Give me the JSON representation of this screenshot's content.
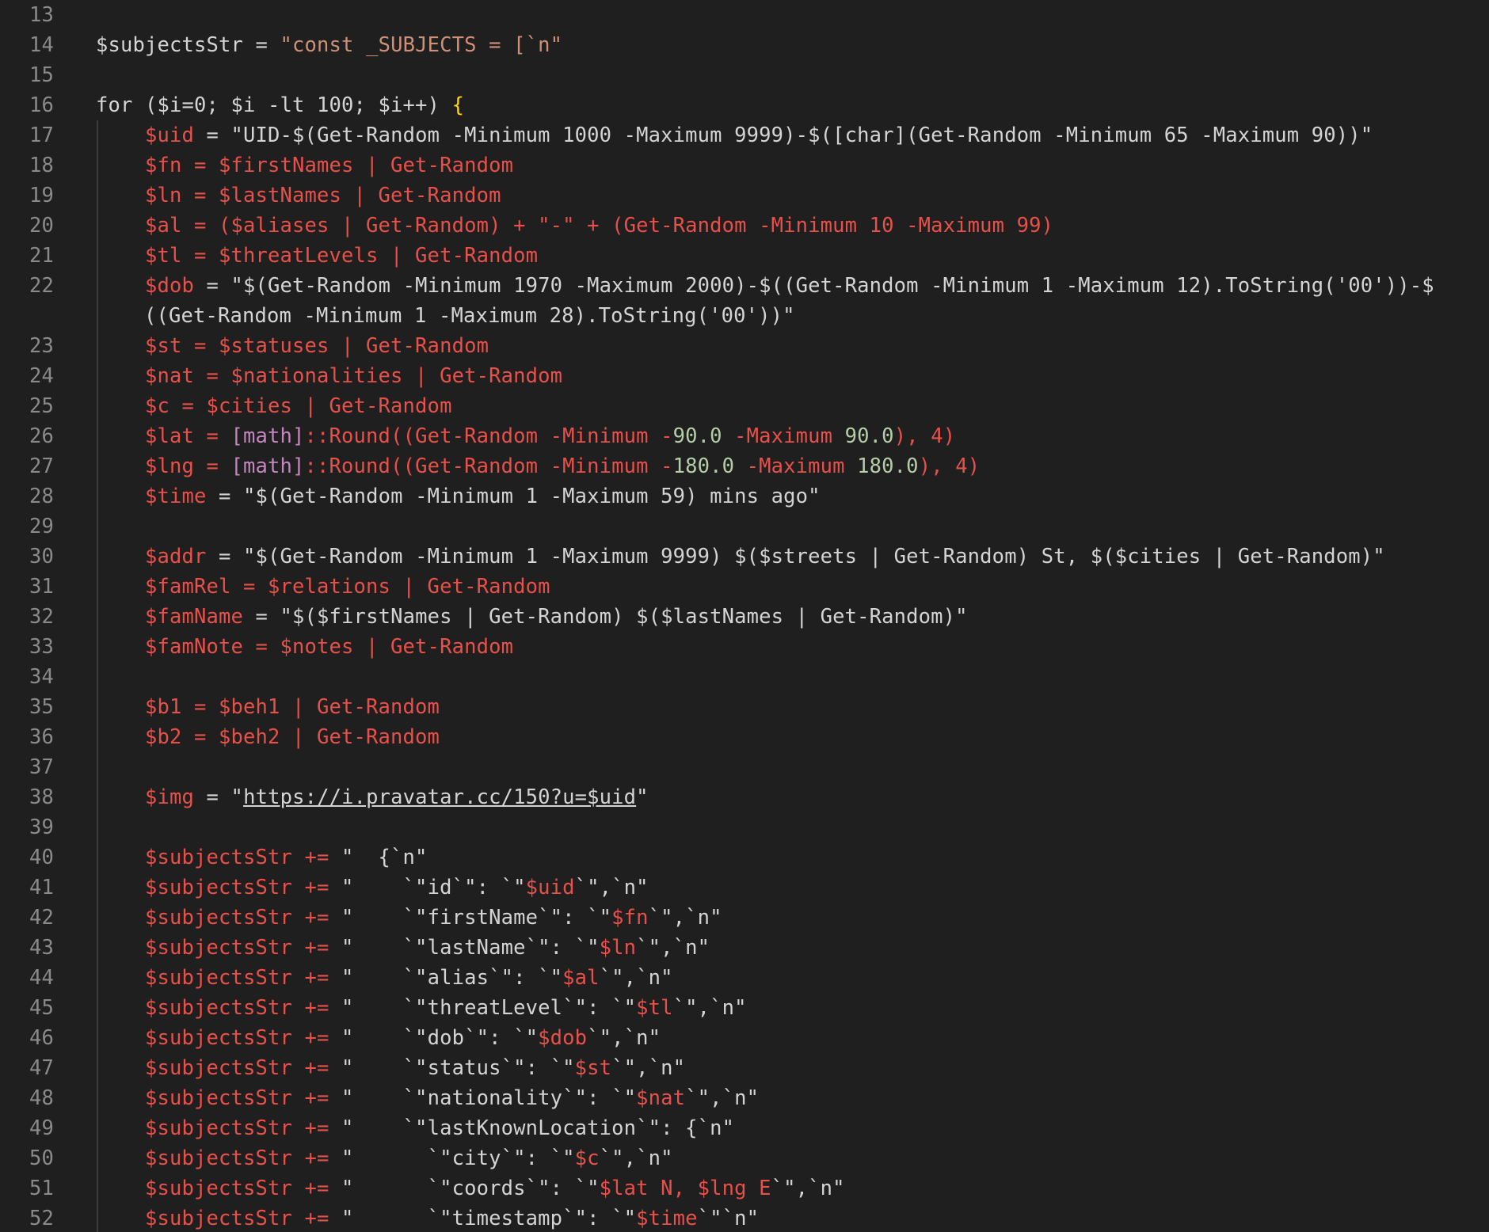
{
  "editor": {
    "colors": {
      "background": "#1f1f1f",
      "gutter_text": "#8a8a8a",
      "plain": "#d4d4d4",
      "variable": "#e8504a",
      "string": "#ce9178",
      "bracket_yellow": "#ffd700",
      "bracket_pink": "#da70d6",
      "number": "#b5cea8",
      "keyword": "#d4d4d4",
      "type": "#c586c0"
    },
    "lines": [
      {
        "n": "13",
        "guide": false,
        "tokens": []
      },
      {
        "n": "14",
        "guide": false,
        "tokens": [
          {
            "t": "$subjectsStr = ",
            "c": "plain"
          },
          {
            "t": "\"const _SUBJECTS = [`n\"",
            "c": "string"
          }
        ]
      },
      {
        "n": "15",
        "guide": false,
        "tokens": []
      },
      {
        "n": "16",
        "guide": false,
        "tokens": [
          {
            "t": "for ($i=0; $i -lt 100; $i++) ",
            "c": "plain"
          },
          {
            "t": "{",
            "c": "bracket_yellow"
          }
        ]
      },
      {
        "n": "17",
        "guide": true,
        "tokens": [
          {
            "t": "    $uid",
            "c": "variable"
          },
          {
            "t": " = ",
            "c": "plain"
          },
          {
            "t": "\"UID-$(Get-Random -Minimum 1000 -Maximum 9999)-$([char](Get-Random -Minimum 65 -Maximum 90))\"",
            "c": "string_light"
          }
        ]
      },
      {
        "n": "18",
        "guide": true,
        "tokens": [
          {
            "t": "    $fn = $firstNames | Get-Random",
            "c": "variable"
          }
        ]
      },
      {
        "n": "19",
        "guide": true,
        "tokens": [
          {
            "t": "    $ln = $lastNames | Get-Random",
            "c": "variable"
          }
        ]
      },
      {
        "n": "20",
        "guide": true,
        "tokens": [
          {
            "t": "    $al = ($aliases | Get-Random) + \"-\" + (Get-Random -Minimum 10 -Maximum 99)",
            "c": "variable"
          }
        ]
      },
      {
        "n": "21",
        "guide": true,
        "tokens": [
          {
            "t": "    $tl = $threatLevels | Get-Random",
            "c": "variable"
          }
        ]
      },
      {
        "n": "22",
        "guide": true,
        "tokens": [
          {
            "t": "    $dob",
            "c": "variable"
          },
          {
            "t": " = ",
            "c": "plain"
          },
          {
            "t": "\"$(Get-Random -Minimum 1970 -Maximum 2000)-$((Get-Random -Minimum 1 -Maximum 12).ToString('00'))-$",
            "c": "string_light"
          }
        ]
      },
      {
        "n": "",
        "guide": true,
        "cont": true,
        "tokens": [
          {
            "t": "((Get-Random -Minimum 1 -Maximum 28).ToString('00'))\"",
            "c": "string_light"
          }
        ]
      },
      {
        "n": "23",
        "guide": true,
        "tokens": [
          {
            "t": "    $st = $statuses | Get-Random",
            "c": "variable"
          }
        ]
      },
      {
        "n": "24",
        "guide": true,
        "tokens": [
          {
            "t": "    $nat = $nationalities | Get-Random",
            "c": "variable"
          }
        ]
      },
      {
        "n": "25",
        "guide": true,
        "tokens": [
          {
            "t": "    $c = $cities | Get-Random",
            "c": "variable"
          }
        ]
      },
      {
        "n": "26",
        "guide": true,
        "tokens": [
          {
            "t": "    $lat = ",
            "c": "variable"
          },
          {
            "t": "[math]",
            "c": "type"
          },
          {
            "t": "::Round((Get-Random -Minimum -",
            "c": "variable"
          },
          {
            "t": "90.0",
            "c": "number"
          },
          {
            "t": " -Maximum ",
            "c": "variable"
          },
          {
            "t": "90.0",
            "c": "number"
          },
          {
            "t": "), 4)",
            "c": "variable"
          }
        ]
      },
      {
        "n": "27",
        "guide": true,
        "tokens": [
          {
            "t": "    $lng = ",
            "c": "variable"
          },
          {
            "t": "[math]",
            "c": "type"
          },
          {
            "t": "::Round((Get-Random -Minimum -",
            "c": "variable"
          },
          {
            "t": "180.0",
            "c": "number"
          },
          {
            "t": " -Maximum ",
            "c": "variable"
          },
          {
            "t": "180.0",
            "c": "number"
          },
          {
            "t": "), 4)",
            "c": "variable"
          }
        ]
      },
      {
        "n": "28",
        "guide": true,
        "tokens": [
          {
            "t": "    $time",
            "c": "variable"
          },
          {
            "t": " = ",
            "c": "plain"
          },
          {
            "t": "\"$(Get-Random -Minimum 1 -Maximum 59) mins ago\"",
            "c": "string_light"
          }
        ]
      },
      {
        "n": "29",
        "guide": true,
        "tokens": []
      },
      {
        "n": "30",
        "guide": true,
        "tokens": [
          {
            "t": "    $addr",
            "c": "variable"
          },
          {
            "t": " = ",
            "c": "plain"
          },
          {
            "t": "\"$(Get-Random -Minimum 1 -Maximum 9999) $($streets | Get-Random) St, $($cities | Get-Random)\"",
            "c": "string_light"
          }
        ]
      },
      {
        "n": "31",
        "guide": true,
        "tokens": [
          {
            "t": "    $famRel = $relations | Get-Random",
            "c": "variable"
          }
        ]
      },
      {
        "n": "32",
        "guide": true,
        "tokens": [
          {
            "t": "    $famName",
            "c": "variable"
          },
          {
            "t": " = ",
            "c": "plain"
          },
          {
            "t": "\"$($firstNames | Get-Random) $($lastNames | Get-Random)\"",
            "c": "string_light"
          }
        ]
      },
      {
        "n": "33",
        "guide": true,
        "tokens": [
          {
            "t": "    $famNote = $notes | Get-Random",
            "c": "variable"
          }
        ]
      },
      {
        "n": "34",
        "guide": true,
        "tokens": []
      },
      {
        "n": "35",
        "guide": true,
        "tokens": [
          {
            "t": "    $b1 = $beh1 | Get-Random",
            "c": "variable"
          }
        ]
      },
      {
        "n": "36",
        "guide": true,
        "tokens": [
          {
            "t": "    $b2 = $beh2 | Get-Random",
            "c": "variable"
          }
        ]
      },
      {
        "n": "37",
        "guide": true,
        "tokens": []
      },
      {
        "n": "38",
        "guide": true,
        "tokens": [
          {
            "t": "    $img",
            "c": "variable"
          },
          {
            "t": " = ",
            "c": "plain"
          },
          {
            "t": "\"",
            "c": "string_light"
          },
          {
            "t": "https://i.pravatar.cc/150?u=$uid",
            "c": "link"
          },
          {
            "t": "\"",
            "c": "string_light"
          }
        ]
      },
      {
        "n": "39",
        "guide": true,
        "tokens": []
      },
      {
        "n": "40",
        "guide": true,
        "tokens": [
          {
            "t": "    $subjectsStr += ",
            "c": "variable"
          },
          {
            "t": "\"  {`n\"",
            "c": "string_light"
          }
        ]
      },
      {
        "n": "41",
        "guide": true,
        "tokens": [
          {
            "t": "    $subjectsStr += ",
            "c": "variable"
          },
          {
            "t": "\"    `\"id`\": `\"",
            "c": "string_light"
          },
          {
            "t": "$uid",
            "c": "variable"
          },
          {
            "t": "`\",`n\"",
            "c": "string_light"
          }
        ]
      },
      {
        "n": "42",
        "guide": true,
        "tokens": [
          {
            "t": "    $subjectsStr += ",
            "c": "variable"
          },
          {
            "t": "\"    `\"firstName`\": `\"",
            "c": "string_light"
          },
          {
            "t": "$fn",
            "c": "variable"
          },
          {
            "t": "`\",`n\"",
            "c": "string_light"
          }
        ]
      },
      {
        "n": "43",
        "guide": true,
        "tokens": [
          {
            "t": "    $subjectsStr += ",
            "c": "variable"
          },
          {
            "t": "\"    `\"lastName`\": `\"",
            "c": "string_light"
          },
          {
            "t": "$ln",
            "c": "variable"
          },
          {
            "t": "`\",`n\"",
            "c": "string_light"
          }
        ]
      },
      {
        "n": "44",
        "guide": true,
        "tokens": [
          {
            "t": "    $subjectsStr += ",
            "c": "variable"
          },
          {
            "t": "\"    `\"alias`\": `\"",
            "c": "string_light"
          },
          {
            "t": "$al",
            "c": "variable"
          },
          {
            "t": "`\",`n\"",
            "c": "string_light"
          }
        ]
      },
      {
        "n": "45",
        "guide": true,
        "tokens": [
          {
            "t": "    $subjectsStr += ",
            "c": "variable"
          },
          {
            "t": "\"    `\"threatLevel`\": `\"",
            "c": "string_light"
          },
          {
            "t": "$tl",
            "c": "variable"
          },
          {
            "t": "`\",`n\"",
            "c": "string_light"
          }
        ]
      },
      {
        "n": "46",
        "guide": true,
        "tokens": [
          {
            "t": "    $subjectsStr += ",
            "c": "variable"
          },
          {
            "t": "\"    `\"dob`\": `\"",
            "c": "string_light"
          },
          {
            "t": "$dob",
            "c": "variable"
          },
          {
            "t": "`\",`n\"",
            "c": "string_light"
          }
        ]
      },
      {
        "n": "47",
        "guide": true,
        "tokens": [
          {
            "t": "    $subjectsStr += ",
            "c": "variable"
          },
          {
            "t": "\"    `\"status`\": `\"",
            "c": "string_light"
          },
          {
            "t": "$st",
            "c": "variable"
          },
          {
            "t": "`\",`n\"",
            "c": "string_light"
          }
        ]
      },
      {
        "n": "48",
        "guide": true,
        "tokens": [
          {
            "t": "    $subjectsStr += ",
            "c": "variable"
          },
          {
            "t": "\"    `\"nationality`\": `\"",
            "c": "string_light"
          },
          {
            "t": "$nat",
            "c": "variable"
          },
          {
            "t": "`\",`n\"",
            "c": "string_light"
          }
        ]
      },
      {
        "n": "49",
        "guide": true,
        "tokens": [
          {
            "t": "    $subjectsStr += ",
            "c": "variable"
          },
          {
            "t": "\"    `\"lastKnownLocation`\": {`n\"",
            "c": "string_light"
          }
        ]
      },
      {
        "n": "50",
        "guide": true,
        "tokens": [
          {
            "t": "    $subjectsStr += ",
            "c": "variable"
          },
          {
            "t": "\"      `\"city`\": `\"",
            "c": "string_light"
          },
          {
            "t": "$c",
            "c": "variable"
          },
          {
            "t": "`\",`n\"",
            "c": "string_light"
          }
        ]
      },
      {
        "n": "51",
        "guide": true,
        "tokens": [
          {
            "t": "    $subjectsStr += ",
            "c": "variable"
          },
          {
            "t": "\"      `\"coords`\": `\"",
            "c": "string_light"
          },
          {
            "t": "$lat",
            "c": "variable"
          },
          {
            "t": " N, ",
            "c": "variable"
          },
          {
            "t": "$lng",
            "c": "variable"
          },
          {
            "t": " E",
            "c": "variable"
          },
          {
            "t": "`\",`n\"",
            "c": "string_light"
          }
        ]
      },
      {
        "n": "52",
        "guide": true,
        "tokens": [
          {
            "t": "    $subjectsStr += ",
            "c": "variable"
          },
          {
            "t": "\"      `\"timestamp`\": `\"",
            "c": "string_light"
          },
          {
            "t": "$time",
            "c": "variable"
          },
          {
            "t": "`\"`n\"",
            "c": "string_light"
          }
        ]
      }
    ]
  }
}
